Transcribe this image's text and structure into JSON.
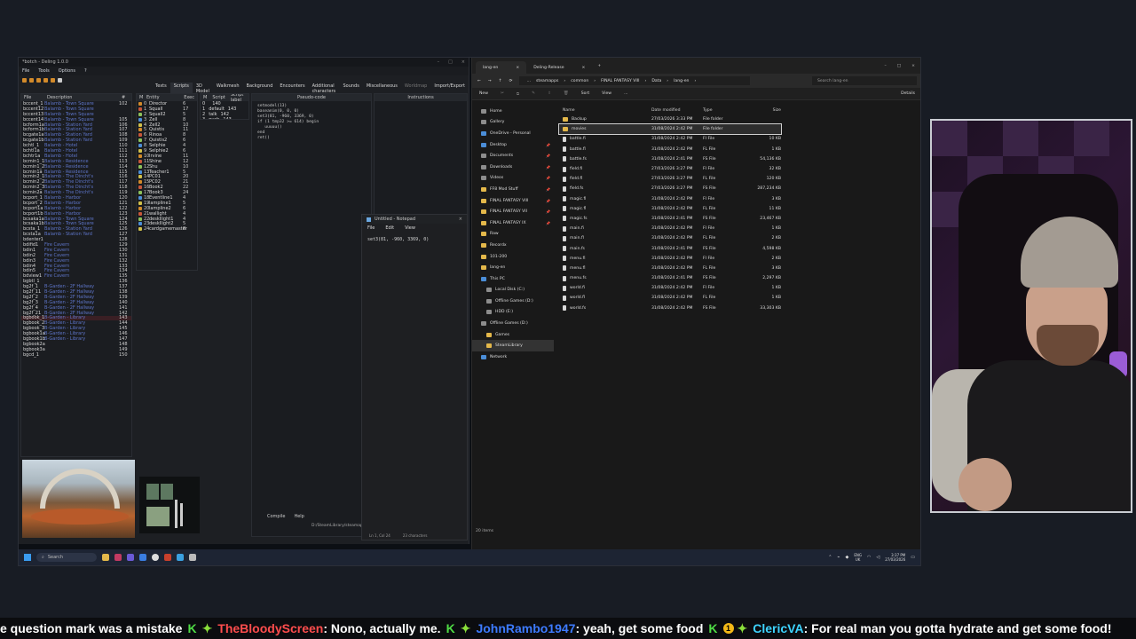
{
  "deling": {
    "title": "*botch - Deling 1.0.0",
    "menu": [
      "File",
      "Tools",
      "Options",
      "?"
    ],
    "tabs": [
      "Texts",
      "Scripts",
      "3D Model",
      "Walkmesh",
      "Background",
      "Encounters",
      "Additional characters",
      "Sounds",
      "Miscellaneous",
      "Worldmap",
      "Import/Export"
    ],
    "file_headers": {
      "file": "File",
      "desc": "Description",
      "num": "#"
    },
    "files": [
      [
        "bccent_1",
        "Balamb - Town Square",
        "102"
      ],
      [
        "bccent12",
        "Balamb - Town Square",
        ""
      ],
      [
        "bccent13",
        "Balamb - Town Square",
        ""
      ],
      [
        "bccent14",
        "Balamb - Town Square",
        "105"
      ],
      [
        "bcform1a",
        "Balamb - Station Yard",
        "106"
      ],
      [
        "bcform1b",
        "Balamb - Station Yard",
        "107"
      ],
      [
        "bcgate1a",
        "Balamb - Station Yard",
        "108"
      ],
      [
        "bcgate1b",
        "Balamb - Station Yard",
        "109"
      ],
      [
        "bchtl_1",
        "Balamb - Hotel",
        "110"
      ],
      [
        "bchtl1a",
        "Balamb - Hotel",
        "111"
      ],
      [
        "bchtr1a",
        "Balamb - Hotel",
        "112"
      ],
      [
        "bcmin1_1",
        "Balamb - Residence",
        "113"
      ],
      [
        "bcmin1_2",
        "Balamb - Residence",
        "114"
      ],
      [
        "bcmin1a",
        "Balamb - Residence",
        "115"
      ],
      [
        "bcmin2_1",
        "Balamb - The Dincht's",
        "116"
      ],
      [
        "bcmin2_2",
        "Balamb - The Dincht's",
        "117"
      ],
      [
        "bcmin2_3",
        "Balamb - The Dincht's",
        "118"
      ],
      [
        "bcmin2a",
        "Balamb - The Dincht's",
        "119"
      ],
      [
        "bcport_1",
        "Balamb - Harbor",
        "120"
      ],
      [
        "bcport_2",
        "Balamb - Harbor",
        "121"
      ],
      [
        "bcport1a",
        "Balamb - Harbor",
        "122"
      ],
      [
        "bcport1b",
        "Balamb - Harbor",
        "123"
      ],
      [
        "bcsaka1a",
        "Balamb - Town Square",
        "124"
      ],
      [
        "bcsaka1b",
        "Balamb - Town Square",
        "125"
      ],
      [
        "bcsta_1",
        "Balamb - Station Yard",
        "126"
      ],
      [
        "bcsta1a",
        "Balamb - Station Yard",
        "127"
      ],
      [
        "bdenter1",
        "",
        "128"
      ],
      [
        "bdifid1",
        "Fire Cavern",
        "129"
      ],
      [
        "bdin1",
        "Fire Cavern",
        "130"
      ],
      [
        "bdin2",
        "Fire Cavern",
        "131"
      ],
      [
        "bdin3",
        "Fire Cavern",
        "132"
      ],
      [
        "bdin4",
        "Fire Cavern",
        "133"
      ],
      [
        "bdin5",
        "Fire Cavern",
        "134"
      ],
      [
        "bdview1",
        "Fire Cavern",
        "135"
      ],
      [
        "bgbtl_1",
        "",
        "136"
      ],
      [
        "bg2f_1",
        "B-Garden - 2F Hallway",
        "137"
      ],
      [
        "bg2f_11",
        "B-Garden - 2F Hallway",
        "138"
      ],
      [
        "bg2f_2",
        "B-Garden - 2F Hallway",
        "139"
      ],
      [
        "bg2f_3",
        "B-Garden - 2F Hallway",
        "140"
      ],
      [
        "bg2f_4",
        "B-Garden - 2F Hallway",
        "141"
      ],
      [
        "bg2f_21",
        "B-Garden - 2F Hallway",
        "142"
      ],
      [
        "bgbook_1",
        "B-Garden - Library",
        "143"
      ],
      [
        "bgbook_2",
        "B-Garden - Library",
        "144"
      ],
      [
        "bgbook_3",
        "B-Garden - Library",
        "145"
      ],
      [
        "bgbook1a",
        "B-Garden - Library",
        "146"
      ],
      [
        "bgbook1b",
        "B-Garden - Library",
        "147"
      ],
      [
        "bgbook2a",
        "",
        "148"
      ],
      [
        "bgbook3a",
        "",
        "149"
      ],
      [
        "bgcd_1",
        "",
        "150"
      ]
    ],
    "entity_headers": {
      "m": "M",
      "entity": "Entity",
      "exec": "Exec"
    },
    "entities": [
      [
        "0",
        "Director",
        "6"
      ],
      [
        "1",
        "Squall",
        "17"
      ],
      [
        "2",
        "Squall2",
        "5"
      ],
      [
        "3",
        "Zell",
        "8"
      ],
      [
        "4",
        "Zell2",
        "10"
      ],
      [
        "5",
        "Quistis",
        "11"
      ],
      [
        "6",
        "Rinoa",
        "8"
      ],
      [
        "7",
        "Quistis2",
        "6"
      ],
      [
        "8",
        "Selphie",
        "4"
      ],
      [
        "9",
        "Selphie2",
        "6"
      ],
      [
        "10",
        "Irvine",
        "11"
      ],
      [
        "11",
        "Shine",
        "12"
      ],
      [
        "12",
        "Shu",
        "10"
      ],
      [
        "13",
        "Teacher1",
        "5"
      ],
      [
        "14",
        "PC01",
        "20"
      ],
      [
        "15",
        "PC02",
        "21"
      ],
      [
        "16",
        "Book2",
        "22"
      ],
      [
        "17",
        "Book3",
        "24"
      ],
      [
        "18",
        "Eventline1",
        "4"
      ],
      [
        "19",
        "lampline1",
        "5"
      ],
      [
        "20",
        "lampline2",
        "6"
      ],
      [
        "21",
        "wallight",
        "4"
      ],
      [
        "22",
        "deskllight1",
        "4"
      ],
      [
        "23",
        "deskllight2",
        "5"
      ],
      [
        "24",
        "cardgamemaster",
        "8"
      ]
    ],
    "script_headers": {
      "m": "M",
      "script": "Script",
      "label": "Script label"
    },
    "scripts": [
      [
        "0",
        "",
        "140"
      ],
      [
        "1",
        "default",
        "143"
      ],
      [
        "2",
        "talk",
        "142"
      ],
      [
        "3",
        "push",
        "143"
      ]
    ],
    "code_header": "Pseudo-code",
    "instr_header": "Instructions",
    "code": [
      "setmodel(13)",
      "baseanim(0, 0, 0)",
      "set3(81, -960, 3369, 0)",
      "if (1 tmp32 >= 614) begin",
      "   uuuuu()",
      "end",
      "ret()"
    ],
    "bottom_buttons": [
      "Compile",
      "Help"
    ],
    "status_path": "D:/SteamLibrary/steamapps/common/FINAL FANTASY VIII/Data/lang-en/field.fs"
  },
  "notepad": {
    "title": "Untitled - Notepad",
    "menu": [
      "File",
      "Edit",
      "View"
    ],
    "content": "set3(81, -960, 3369, 0)",
    "status_pos": "Ln 1, Col 24",
    "status_chars": "23 characters"
  },
  "explorer": {
    "tab_active": "lang-en",
    "tab_2": "Deling-Release",
    "path": [
      "steamapps",
      "common",
      "FINAL FANTASY VIII",
      "Data",
      "lang-en"
    ],
    "search_placeholder": "Search lang-en",
    "commands": [
      "New",
      "Sort",
      "View",
      "...",
      "Details"
    ],
    "nav": [
      {
        "label": "Home",
        "kind": "gray",
        "sub": false
      },
      {
        "label": "Gallery",
        "kind": "gray",
        "sub": false
      },
      {
        "label": "OneDrive - Personal",
        "kind": "blue",
        "sub": false
      },
      {
        "label": "Desktop",
        "kind": "blue",
        "sub": false
      },
      {
        "label": "Documents",
        "kind": "gray",
        "sub": false
      },
      {
        "label": "Downloads",
        "kind": "gray",
        "sub": false
      },
      {
        "label": "Videos",
        "kind": "gray",
        "sub": false
      },
      {
        "label": "FF8 Mod Stuff",
        "kind": "yellow",
        "sub": false
      },
      {
        "label": "FINAL FANTASY VIII",
        "kind": "yellow",
        "sub": false
      },
      {
        "label": "FINAL FANTASY VII",
        "kind": "yellow",
        "sub": false
      },
      {
        "label": "FINAL FANTASY IX",
        "kind": "yellow",
        "sub": false
      },
      {
        "label": "Raw",
        "kind": "yellow",
        "sub": false
      },
      {
        "label": "Recordx",
        "kind": "yellow",
        "sub": false
      },
      {
        "label": "101-200",
        "kind": "yellow",
        "sub": false
      },
      {
        "label": "lang-en",
        "kind": "yellow",
        "sub": false
      },
      {
        "label": "This PC",
        "kind": "blue",
        "sub": false
      },
      {
        "label": "Local Disk (C:)",
        "kind": "gray",
        "sub": true
      },
      {
        "label": "Offline Games (D:)",
        "kind": "gray",
        "sub": true
      },
      {
        "label": "HDD (E:)",
        "kind": "gray",
        "sub": true
      },
      {
        "label": "Offline Games (D:)",
        "kind": "gray",
        "sub": false
      },
      {
        "label": "Games",
        "kind": "yellow",
        "sub": true
      },
      {
        "label": "SteamLibrary",
        "kind": "yellow",
        "sub": true
      },
      {
        "label": "Network",
        "kind": "blue",
        "sub": false
      }
    ],
    "headers": {
      "name": "Name",
      "date": "Date modified",
      "type": "Type",
      "size": "Size"
    },
    "files": [
      {
        "name": "Backup",
        "date": "27/03/2026 3:33 PM",
        "type": "File folder",
        "size": "",
        "folder": true
      },
      {
        "name": "movies",
        "date": "31/08/2024 2:42 PM",
        "type": "File folder",
        "size": "",
        "folder": true
      },
      {
        "name": "battle.fi",
        "date": "31/08/2024 2:42 PM",
        "type": "FI File",
        "size": "10 KB",
        "folder": false
      },
      {
        "name": "battle.fl",
        "date": "31/08/2024 2:42 PM",
        "type": "FL File",
        "size": "1 KB",
        "folder": false
      },
      {
        "name": "battle.fs",
        "date": "31/08/2024 2:41 PM",
        "type": "FS File",
        "size": "54,136 KB",
        "folder": false
      },
      {
        "name": "field.fi",
        "date": "27/03/2026 3:27 PM",
        "type": "FI File",
        "size": "32 KB",
        "folder": false
      },
      {
        "name": "field.fl",
        "date": "27/03/2026 3:27 PM",
        "type": "FL File",
        "size": "120 KB",
        "folder": false
      },
      {
        "name": "field.fs",
        "date": "27/03/2026 3:27 PM",
        "type": "FS File",
        "size": "287,234 KB",
        "folder": false
      },
      {
        "name": "magic.fi",
        "date": "31/08/2024 2:42 PM",
        "type": "FI File",
        "size": "3 KB",
        "folder": false
      },
      {
        "name": "magic.fl",
        "date": "31/08/2024 2:42 PM",
        "type": "FL File",
        "size": "11 KB",
        "folder": false
      },
      {
        "name": "magic.fs",
        "date": "31/08/2024 2:41 PM",
        "type": "FS File",
        "size": "23,467 KB",
        "folder": false
      },
      {
        "name": "main.fi",
        "date": "31/08/2024 2:42 PM",
        "type": "FI File",
        "size": "1 KB",
        "folder": false
      },
      {
        "name": "main.fl",
        "date": "31/08/2024 2:42 PM",
        "type": "FL File",
        "size": "2 KB",
        "folder": false
      },
      {
        "name": "main.fs",
        "date": "31/08/2024 2:41 PM",
        "type": "FS File",
        "size": "4,598 KB",
        "folder": false
      },
      {
        "name": "menu.fi",
        "date": "31/08/2024 2:42 PM",
        "type": "FI File",
        "size": "2 KB",
        "folder": false
      },
      {
        "name": "menu.fl",
        "date": "31/08/2024 2:42 PM",
        "type": "FL File",
        "size": "3 KB",
        "folder": false
      },
      {
        "name": "menu.fs",
        "date": "31/08/2024 2:41 PM",
        "type": "FS File",
        "size": "2,297 KB",
        "folder": false
      },
      {
        "name": "world.fi",
        "date": "31/08/2024 2:42 PM",
        "type": "FI File",
        "size": "1 KB",
        "folder": false
      },
      {
        "name": "world.fl",
        "date": "31/08/2024 2:42 PM",
        "type": "FL File",
        "size": "1 KB",
        "folder": false
      },
      {
        "name": "world.fs",
        "date": "31/08/2024 2:42 PM",
        "type": "FS File",
        "size": "33,303 KB",
        "folder": false
      }
    ],
    "item_count": "20 items"
  },
  "taskbar": {
    "search": "Search",
    "lang": "ENG",
    "region": "UK",
    "time": "3:37 PM",
    "date": "27/03/2026"
  },
  "ticker": [
    {
      "user": "",
      "msg": "e question mark was a mistake",
      "user_color": "#ffffff"
    },
    {
      "user": "TheBloodyScreen",
      "msg": ": Nono, actually me.",
      "user_color": "#ff4d4d"
    },
    {
      "user": "JohnRambo1947",
      "msg": ": yeah, get some food",
      "user_color": "#3d7bff"
    },
    {
      "user": "ClericVA",
      "msg": ": For real man you gotta hydrate and get some food!",
      "user_color": "#3ed4ff"
    }
  ],
  "ticker_badge": "1",
  "colors": {
    "accent": "#e4b84a",
    "folder": "#e4b84a",
    "link": "#5e75c9"
  }
}
